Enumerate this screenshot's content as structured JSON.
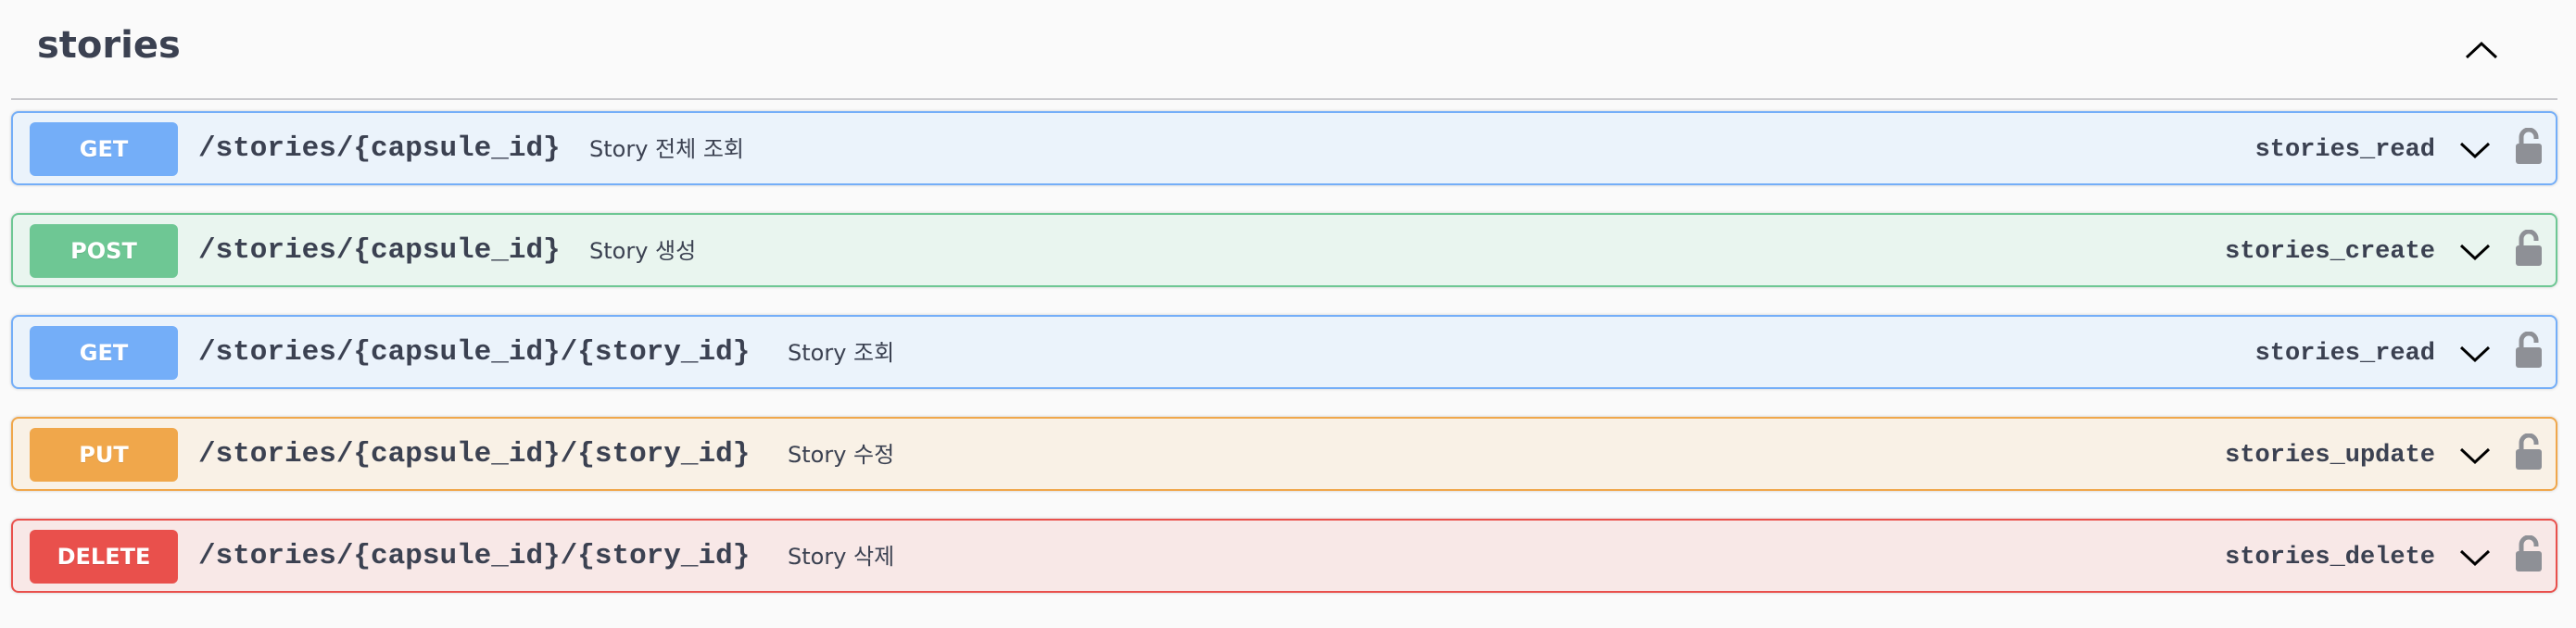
{
  "tag": {
    "title": "stories"
  },
  "operations": [
    {
      "method": "GET",
      "path": "/stories/{capsule_id}",
      "summary": "Story 전체 조회",
      "operation_id": "stories_read",
      "color": "#74aef8",
      "bg": "#ebf3fb",
      "border": "#74aef8"
    },
    {
      "method": "POST",
      "path": "/stories/{capsule_id}",
      "summary": "Story 생성",
      "operation_id": "stories_create",
      "color": "#6ec794",
      "bg": "#e9f5ef",
      "border": "#6ec794"
    },
    {
      "method": "GET",
      "path": "/stories/{capsule_id}/{story_id}",
      "summary": "Story 조회",
      "operation_id": "stories_read",
      "color": "#74aef8",
      "bg": "#ebf3fb",
      "border": "#74aef8"
    },
    {
      "method": "PUT",
      "path": "/stories/{capsule_id}/{story_id}",
      "summary": "Story 수정",
      "operation_id": "stories_update",
      "color": "#f0a74b",
      "bg": "#f9f1e6",
      "border": "#f0a74b"
    },
    {
      "method": "DELETE",
      "path": "/stories/{capsule_id}/{story_id}",
      "summary": "Story 삭제",
      "operation_id": "stories_delete",
      "color": "#e9504c",
      "bg": "#f8e8e7",
      "border": "#e9504c"
    }
  ]
}
